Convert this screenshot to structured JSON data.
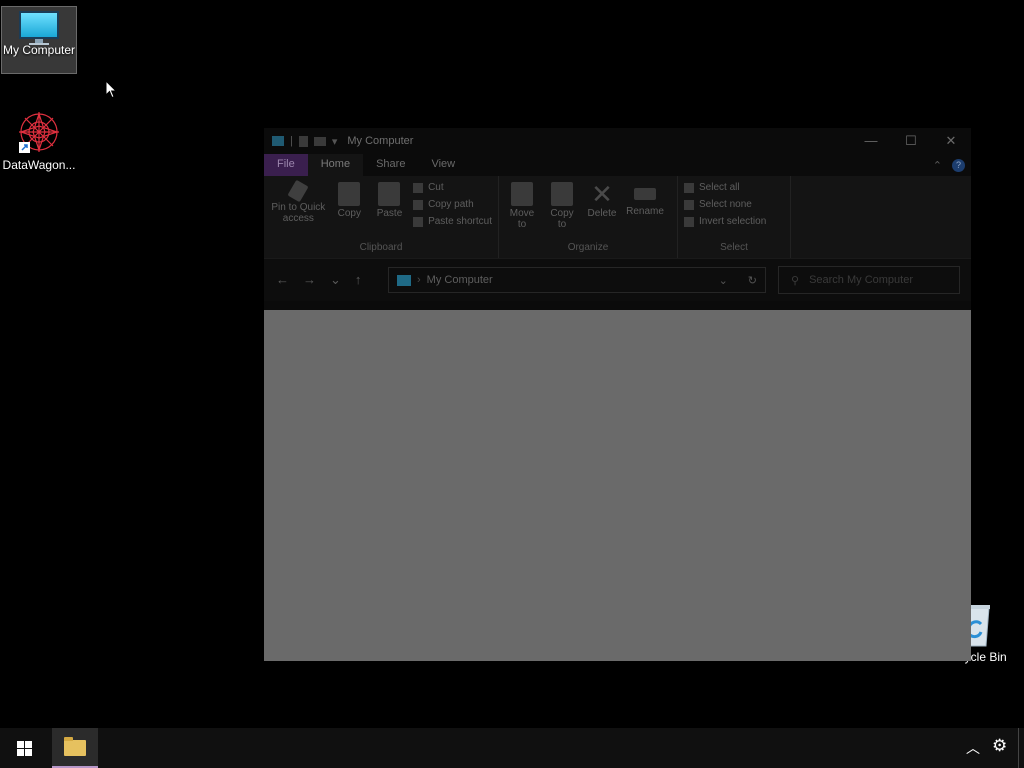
{
  "desktop": {
    "icons": [
      {
        "label": "My Computer"
      },
      {
        "label": "DataWagon..."
      },
      {
        "label": "Recycle Bin"
      }
    ]
  },
  "window": {
    "title": "My Computer",
    "tabs": [
      "File",
      "Home",
      "Share",
      "View"
    ],
    "ribbon": {
      "clipboard": {
        "pin_label": "Pin to Quick access",
        "copy_label": "Copy",
        "paste_label": "Paste",
        "cut_label": "Cut",
        "copy_path_label": "Copy path",
        "paste_shortcut_label": "Paste shortcut",
        "group_label": "Clipboard"
      },
      "organize": {
        "move_to_label": "Move to",
        "copy_to_label": "Copy to",
        "delete_label": "Delete",
        "rename_label": "Rename",
        "group_label": "Organize"
      },
      "select": {
        "select_all_label": "Select all",
        "select_none_label": "Select none",
        "invert_selection_label": "Invert selection",
        "group_label": "Select"
      }
    },
    "address": {
      "path": "My Computer",
      "search_placeholder": "Search My Computer"
    }
  },
  "taskbar": {
    "colors": {
      "active_indicator": "#b696c8"
    }
  }
}
